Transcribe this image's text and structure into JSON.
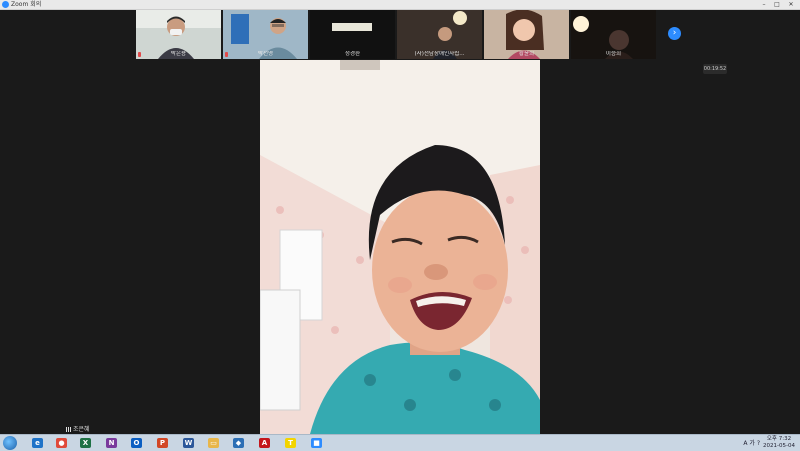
{
  "window": {
    "title": "Zoom 회의",
    "controls": [
      "–",
      "□",
      "✕"
    ]
  },
  "gallery": {
    "participants": [
      {
        "name": "박은용"
      },
      {
        "name": "박선영"
      },
      {
        "name": "정경환"
      },
      {
        "name": "(사)전남장애인자립..."
      },
      {
        "name": "황윤희"
      },
      {
        "name": "이승희"
      }
    ],
    "next_label": "›"
  },
  "timer": {
    "text": "00:19:52"
  },
  "speaker": {
    "name": "조은혜"
  },
  "taskbar": {
    "apps": [
      {
        "icon": "ie-icon",
        "glyph": "e",
        "color": "#1e73c8"
      },
      {
        "icon": "chrome-icon",
        "glyph": "●",
        "color": "#e04a3a"
      },
      {
        "icon": "excel-icon",
        "glyph": "X",
        "color": "#1e7145"
      },
      {
        "icon": "onenote-icon",
        "glyph": "N",
        "color": "#7a3a9c"
      },
      {
        "icon": "outlook-icon",
        "glyph": "O",
        "color": "#0a5ec2"
      },
      {
        "icon": "powerpoint-icon",
        "glyph": "P",
        "color": "#d24726"
      },
      {
        "icon": "word-icon",
        "glyph": "W",
        "color": "#2b579a"
      },
      {
        "icon": "explorer-icon",
        "glyph": "▭",
        "color": "#e8b64a"
      },
      {
        "icon": "app-icon",
        "glyph": "◆",
        "color": "#2c6fb5"
      },
      {
        "icon": "acrobat-icon",
        "glyph": "A",
        "color": "#c4161c"
      },
      {
        "icon": "kakaotalk-icon",
        "glyph": "T",
        "color": "#f3d400"
      },
      {
        "icon": "zoom-icon",
        "glyph": "■",
        "color": "#2d8cff"
      }
    ],
    "tray_text": "A 가 ?",
    "clock_time": "오후 7:32",
    "clock_date": "2021-05-04"
  }
}
